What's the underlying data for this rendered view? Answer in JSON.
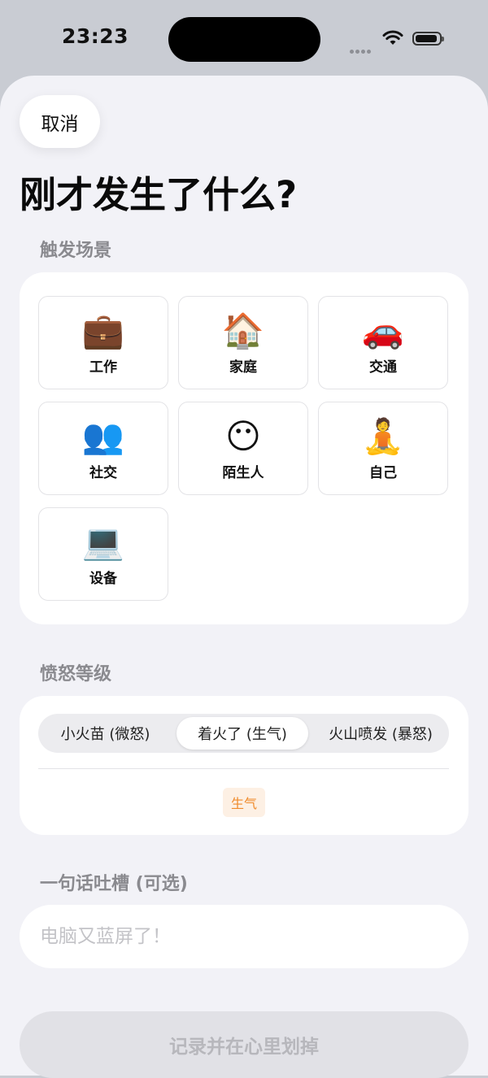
{
  "status_bar": {
    "time": "23:23"
  },
  "header": {
    "cancel_label": "取消",
    "title": "刚才发生了什么?"
  },
  "scene": {
    "label": "触发场景",
    "tiles": [
      {
        "icon": "💼",
        "icon_name": "briefcase-icon",
        "label": "工作"
      },
      {
        "icon": "🏠",
        "icon_name": "house-icon",
        "label": "家庭"
      },
      {
        "icon": "🚗",
        "icon_name": "car-icon",
        "label": "交通"
      },
      {
        "icon": "👥",
        "icon_name": "people-icon",
        "label": "社交"
      },
      {
        "icon": "😶",
        "icon_name": "no-mouth-face-icon",
        "label": "陌生人"
      },
      {
        "icon": "🧘",
        "icon_name": "meditation-icon",
        "label": "自己"
      },
      {
        "icon": "💻",
        "icon_name": "laptop-icon",
        "label": "设备"
      }
    ]
  },
  "anger": {
    "label": "愤怒等级",
    "options": [
      "小火苗 (微怒)",
      "着火了 (生气)",
      "火山喷发 (暴怒)"
    ],
    "selected_index": 1,
    "badge": "生气",
    "badge_color": "#f08a2a"
  },
  "vent": {
    "label": "一句话吐槽 (可选)",
    "placeholder": "电脑又蓝屏了！"
  },
  "submit": {
    "label": "记录并在心里划掉"
  }
}
